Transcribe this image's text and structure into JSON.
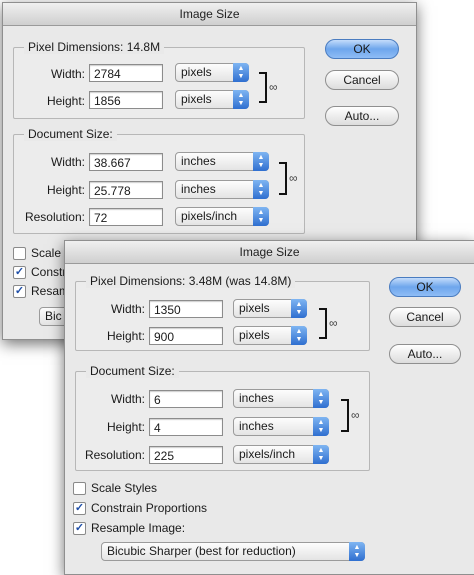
{
  "back": {
    "title": "Image Size",
    "pixel_dimensions": {
      "label": "Pixel Dimensions:",
      "size": "14.8M"
    },
    "pixel": {
      "width_label": "Width:",
      "width_value": "2784",
      "width_unit": "pixels",
      "height_label": "Height:",
      "height_value": "1856",
      "height_unit": "pixels"
    },
    "document": {
      "legend": "Document Size:",
      "width_label": "Width:",
      "width_value": "38.667",
      "width_unit": "inches",
      "height_label": "Height:",
      "height_value": "25.778",
      "height_unit": "inches",
      "res_label": "Resolution:",
      "res_value": "72",
      "res_unit": "pixels/inch"
    },
    "buttons": {
      "ok": "OK",
      "cancel": "Cancel",
      "auto": "Auto..."
    },
    "checkboxes": {
      "scale": "Scale S",
      "constrain": "Constr",
      "resample": "Resam"
    },
    "resample_method": "Bic"
  },
  "front": {
    "title": "Image Size",
    "pixel_dimensions": {
      "label": "Pixel Dimensions:",
      "size": "3.48M (was 14.8M)"
    },
    "pixel": {
      "width_label": "Width:",
      "width_value": "1350",
      "width_unit": "pixels",
      "height_label": "Height:",
      "height_value": "900",
      "height_unit": "pixels"
    },
    "document": {
      "legend": "Document Size:",
      "width_label": "Width:",
      "width_value": "6",
      "width_unit": "inches",
      "height_label": "Height:",
      "height_value": "4",
      "height_unit": "inches",
      "res_label": "Resolution:",
      "res_value": "225",
      "res_unit": "pixels/inch"
    },
    "buttons": {
      "ok": "OK",
      "cancel": "Cancel",
      "auto": "Auto..."
    },
    "checkboxes": {
      "scale": {
        "label": "Scale Styles",
        "checked": false
      },
      "constrain": {
        "label": "Constrain Proportions",
        "checked": true
      },
      "resample": {
        "label": "Resample Image:",
        "checked": true
      }
    },
    "resample_method": "Bicubic Sharper (best for reduction)"
  },
  "icons": {
    "arrows": "up-down-arrows-icon",
    "link": "chain-link-icon",
    "check": "checkmark-icon"
  },
  "colors": {
    "default_button": "#6ea6ec",
    "stepper": "#2f6fd0",
    "dialog_bg": "#e9e9e9"
  }
}
